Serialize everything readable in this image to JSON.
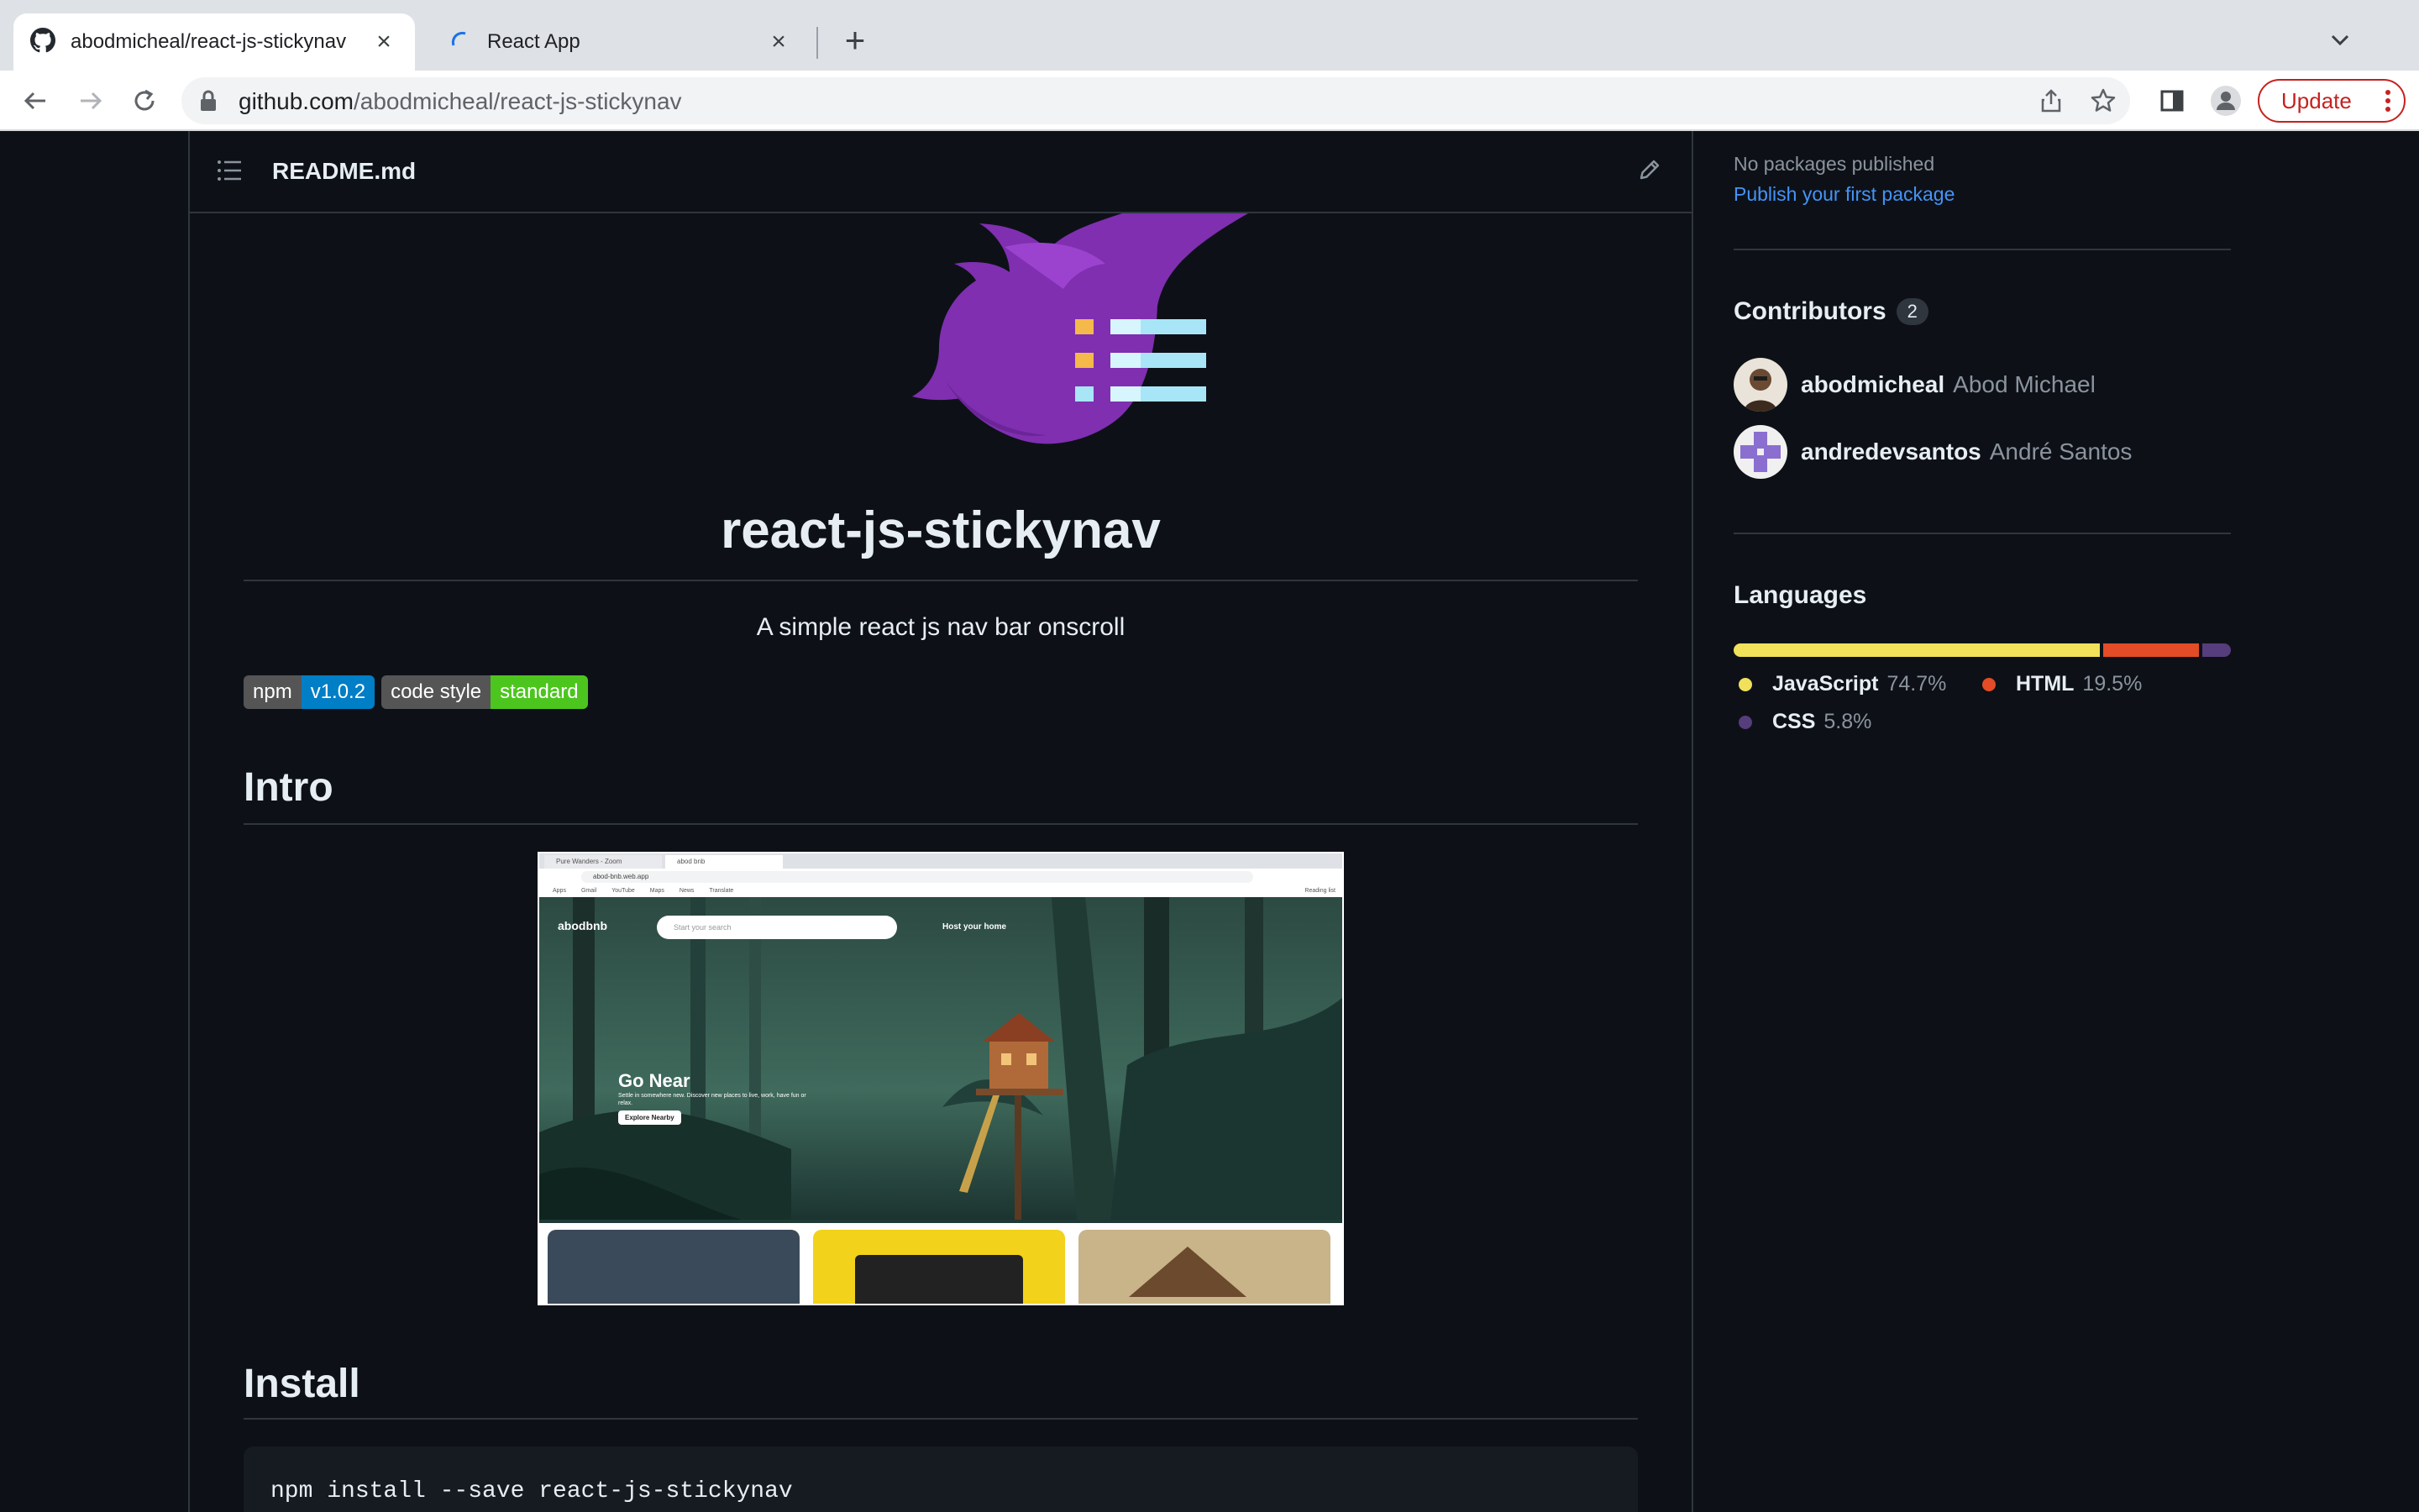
{
  "browser": {
    "tabs": [
      {
        "title": "abodmicheal/react-js-stickynav",
        "active": true
      },
      {
        "title": "React App",
        "active": false
      }
    ],
    "url_host": "github.com",
    "url_path": "/abodmicheal/react-js-stickynav",
    "update_label": "Update"
  },
  "readme": {
    "filename": "README.md",
    "title": "react-js-stickynav",
    "subtitle": "A simple react js nav bar onscroll",
    "badges": [
      {
        "left": "npm",
        "right": "v1.0.2",
        "color": "#007ec6"
      },
      {
        "left": "code style",
        "right": "standard",
        "color": "#4cc61e"
      }
    ],
    "sections": {
      "intro": "Intro",
      "install": "Install"
    },
    "install_command": "npm install --save react-js-stickynav"
  },
  "screenshot": {
    "tabs": [
      "Pure Wanders - Zoom",
      "abod bnb"
    ],
    "url": "abod-bnb.web.app",
    "bookmarks": [
      "Apps",
      "Gmail",
      "YouTube",
      "Maps",
      "News",
      "Translate",
      "Reading list"
    ],
    "brand": "abodbnb",
    "search_placeholder": "Start your search",
    "host_link": "Host your home",
    "hero_title": "Go Near",
    "hero_text": "Settle in somewhere new. Discover new places to live, work, have fun or relax.",
    "hero_button": "Explore Nearby"
  },
  "sidebar": {
    "packages_text": "No packages published",
    "packages_link": "Publish your first package",
    "contributors_title": "Contributors",
    "contributors_count": "2",
    "contributors": [
      {
        "login": "abodmicheal",
        "name": "Abod Michael"
      },
      {
        "login": "andredevsantos",
        "name": "André Santos"
      }
    ],
    "languages_title": "Languages",
    "languages": [
      {
        "name": "JavaScript",
        "percent": "74.7%",
        "value": 74.7,
        "color": "#f1e05a"
      },
      {
        "name": "HTML",
        "percent": "19.5%",
        "value": 19.5,
        "color": "#e34c26"
      },
      {
        "name": "CSS",
        "percent": "5.8%",
        "value": 5.8,
        "color": "#563d7c"
      }
    ]
  }
}
